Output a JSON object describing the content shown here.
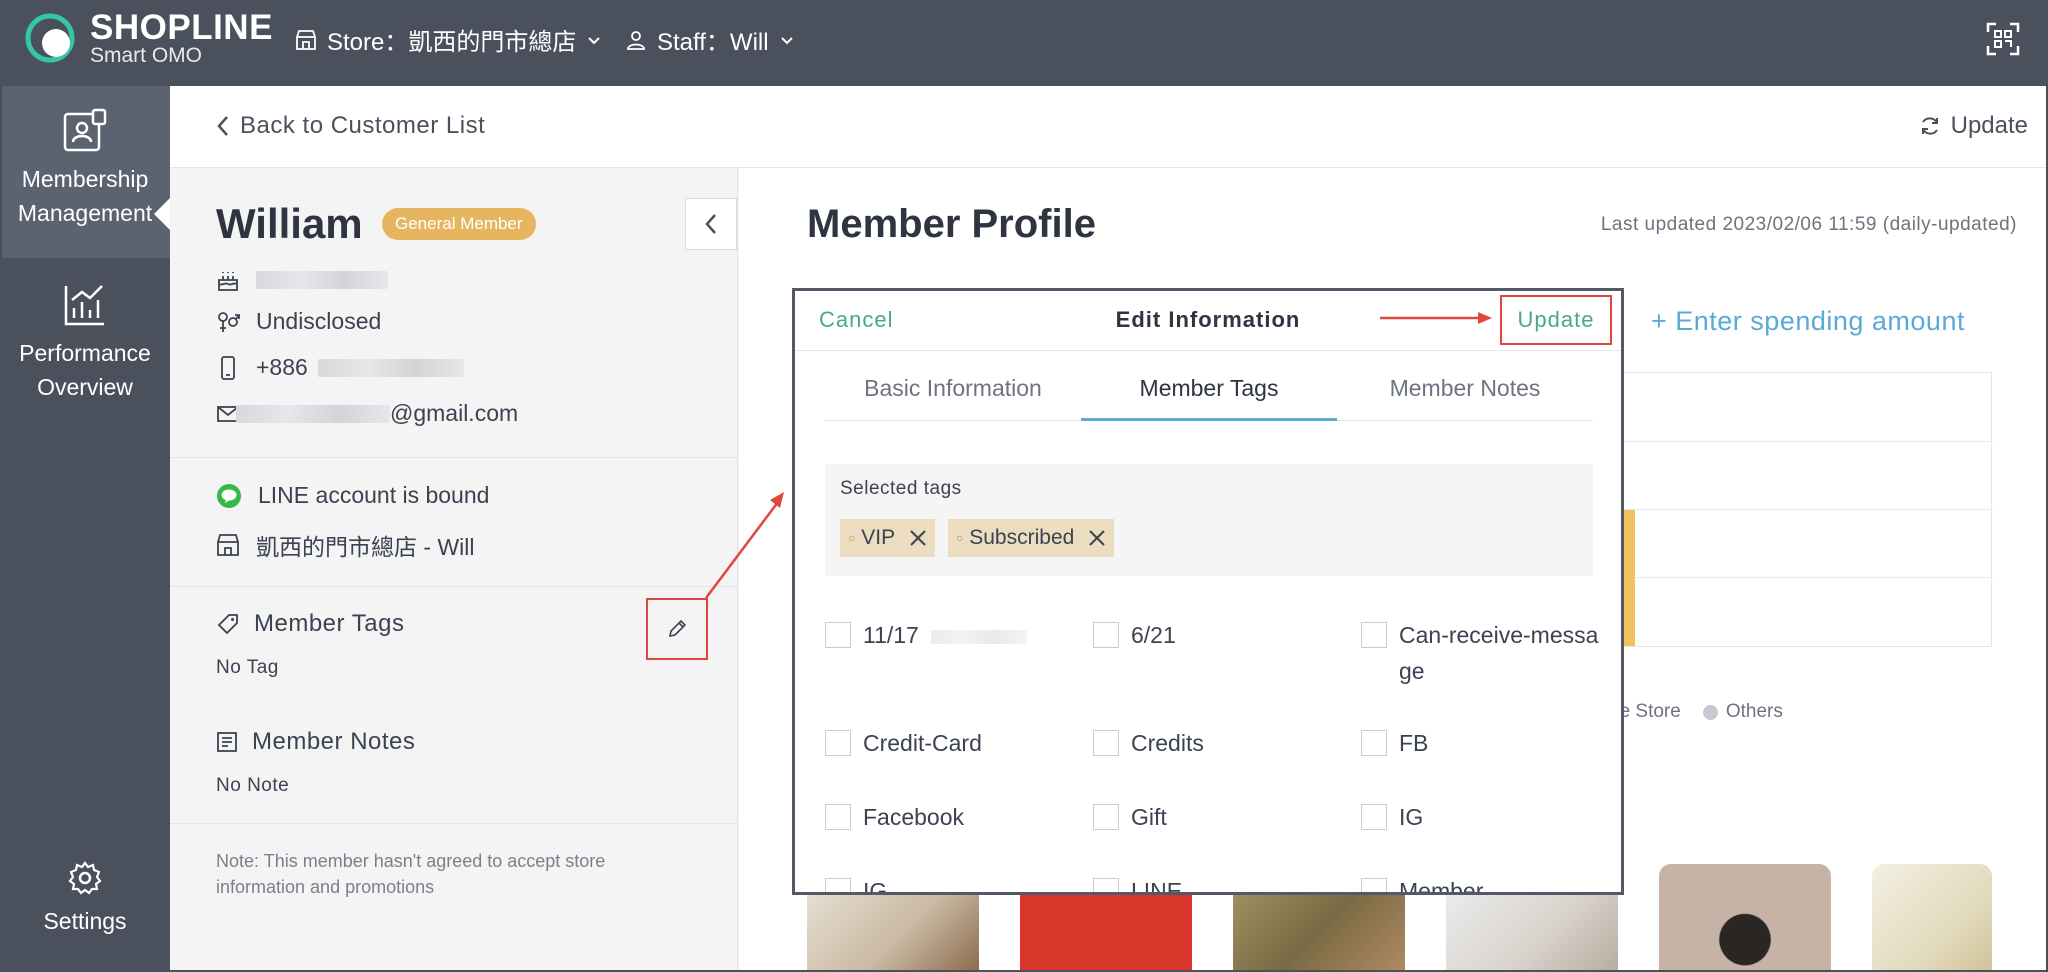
{
  "topbar": {
    "brand": "SHOPLINE",
    "brand_sub": "Smart OMO",
    "store_label": "Store：凱西的門市總店",
    "staff_label": "Staff：Will"
  },
  "leftnav": {
    "items": [
      {
        "line1": "Membership",
        "line2": "Management"
      },
      {
        "line1": "Performance",
        "line2": "Overview"
      },
      {
        "line1": "Settings"
      }
    ]
  },
  "header": {
    "back_label": "Back to Customer List",
    "update_label": "Update"
  },
  "profile": {
    "name": "William",
    "badge": "General Member",
    "gender": "Undisclosed",
    "phone_prefix": "+886",
    "email_suffix": "@gmail.com",
    "line_status": "LINE account is bound",
    "store_staff": "凱西的門市總店 - Will",
    "tags_title": "Member Tags",
    "tags_value": "No Tag",
    "notes_title": "Member Notes",
    "notes_value": "No Note",
    "consent_note": "Note: This member hasn't agreed to accept store information and promotions",
    "colors": {
      "badge": "#e5b65f",
      "line_green": "#36b84a"
    }
  },
  "main": {
    "title": "Member Profile",
    "last_updated": "Last updated 2023/02/06 11:59 (daily-updated)",
    "spend_link": "+ Enter spending amount",
    "legend_partial": "ne Store",
    "legend_others": "Others"
  },
  "modal": {
    "cancel": "Cancel",
    "title": "Edit Information",
    "update": "Update",
    "tabs": [
      "Basic Information",
      "Member Tags",
      "Member Notes"
    ],
    "active_tab": 1,
    "selected_label": "Selected tags",
    "selected_tags": [
      "VIP",
      "Subscribed"
    ],
    "tags": [
      {
        "label": "11/17"
      },
      {
        "label": "6/21"
      },
      {
        "label": "Can-receive-message"
      },
      {
        "label": "Credit-Card"
      },
      {
        "label": "Credits"
      },
      {
        "label": "FB"
      },
      {
        "label": "Facebook"
      },
      {
        "label": "Gift"
      },
      {
        "label": "IG"
      },
      {
        "label": "IG"
      },
      {
        "label": "LINE"
      },
      {
        "label": "Member"
      }
    ],
    "colors": {
      "accent_green": "#4aa88a",
      "tab_ink": "#5aaad6",
      "highlight": "#e0473c"
    }
  }
}
